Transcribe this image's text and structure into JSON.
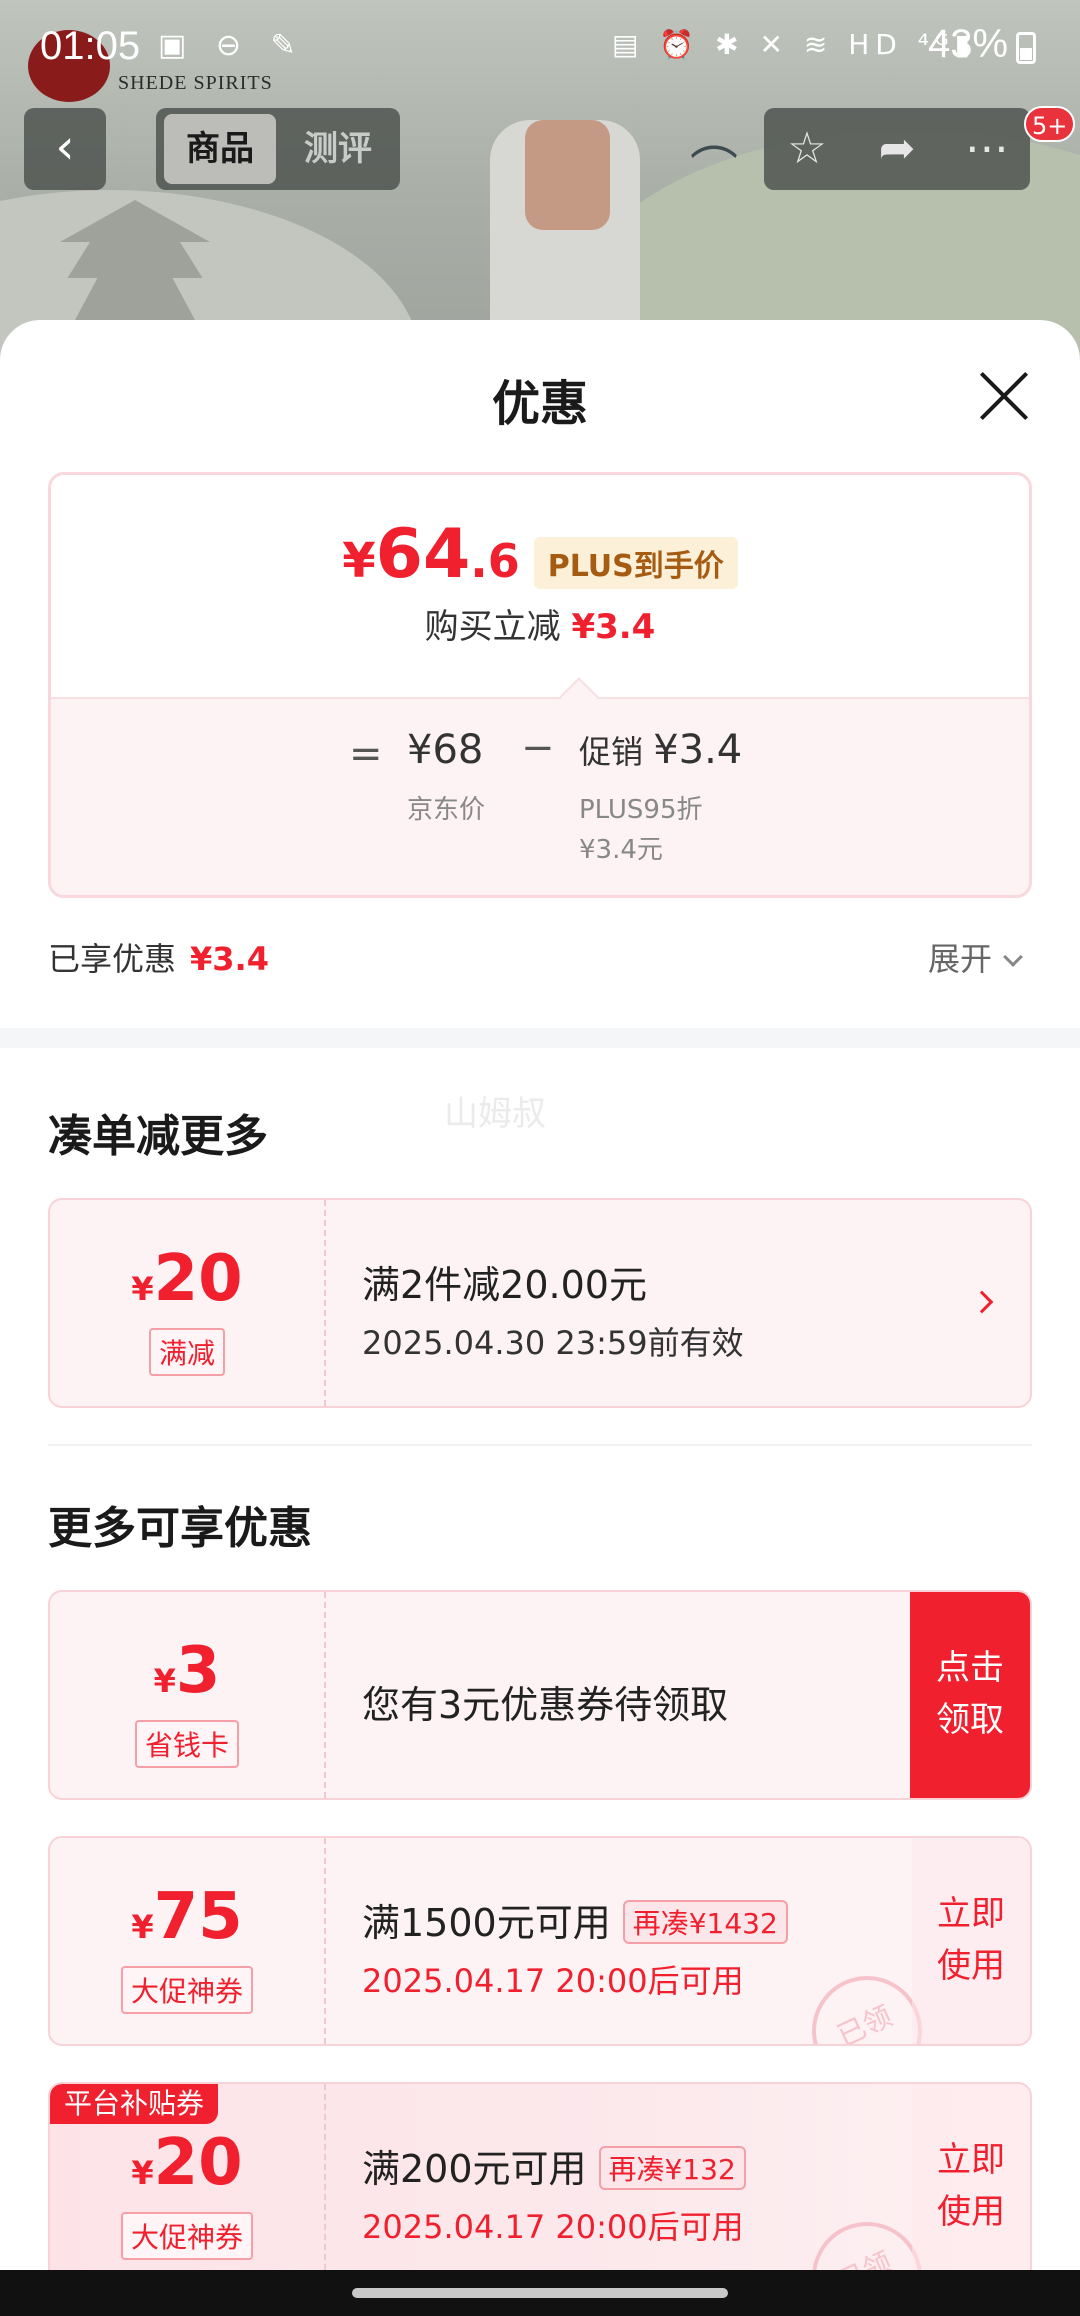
{
  "status_bar": {
    "time": "01:05",
    "left_icons": "▣ ⊖ ✎",
    "right_icons": "▤ ⏰ ✱ ✕ ≋ HD ⁴ᴳ▮",
    "battery": "43%"
  },
  "header": {
    "logo_text": "SHEDE SPIRITS",
    "tabs": [
      "商品",
      "测评"
    ],
    "active_tab": "商品",
    "cart_badge": "5+",
    "icons": [
      "back-icon",
      "star-icon",
      "share-icon",
      "more-icon"
    ]
  },
  "sheet": {
    "title": "优惠",
    "price": {
      "yen": "¥",
      "integer": "64",
      "decimal": ".6",
      "tag": "PLUS到手价",
      "reduce_label": "购买立减",
      "reduce_value": "¥3.4"
    },
    "calc": {
      "equals": "=",
      "jd_price": "¥68",
      "jd_label": "京东价",
      "minus": "−",
      "promo_label": "促销",
      "promo_value": "¥3.4",
      "promo_sub1": "PLUS95折",
      "promo_sub2": "¥3.4元"
    },
    "enjoyed_label": "已享优惠",
    "enjoyed_value": "¥3.4",
    "expand_label": "展开",
    "watermark": "山姆叔"
  },
  "sections": {
    "more_deals_title": "凑单减更多",
    "more_coupons_title": "更多可享优惠"
  },
  "coupons": [
    {
      "yen": "¥",
      "amount": "20",
      "tag": "满减",
      "main": "满2件减20.00元",
      "sub": "2025.04.30 23:59前有效"
    },
    {
      "yen": "¥",
      "amount": "3",
      "tag": "省钱卡",
      "main": "您有3元优惠券待领取",
      "action": "点击领取"
    },
    {
      "yen": "¥",
      "amount": "75",
      "tag": "大促神券",
      "main": "满1500元可用",
      "pill": "再凑¥1432",
      "sub": "2025.04.17 20:00后可用",
      "action": "立即使用",
      "stamp": "已领"
    },
    {
      "yen": "¥",
      "amount": "20",
      "tag": "大促神券",
      "corner": "平台补贴券",
      "main": "满200元可用",
      "pill": "再凑¥132",
      "sub": "2025.04.17 20:00后可用",
      "action": "立即使用",
      "stamp": "已领"
    }
  ],
  "colors": {
    "accent": "#f0202e",
    "plus_tag_bg": "#fdf0d8",
    "plus_tag_text": "#a65b12"
  }
}
